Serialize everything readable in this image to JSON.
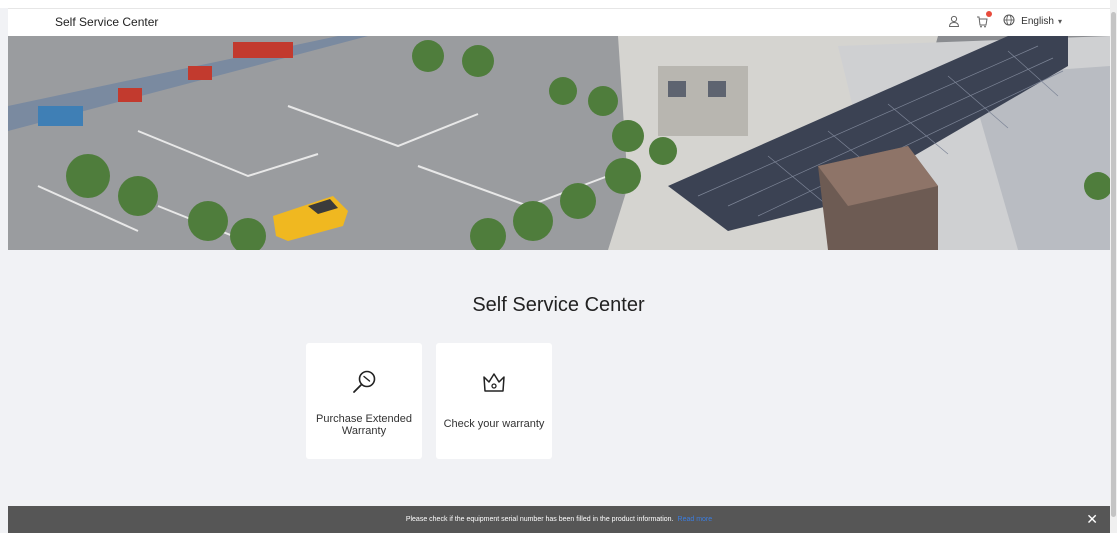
{
  "header": {
    "brand": "Self Service Center",
    "icons": [
      "user-icon",
      "cart-icon",
      "globe-icon"
    ],
    "language": {
      "label": "English",
      "caret": "▾"
    }
  },
  "hero": {
    "image": "aerial-view-of-solar-panel-building-and-parking-lot"
  },
  "main": {
    "title": "Self Service Center",
    "cards": [
      {
        "label": "Purchase Extended Warranty",
        "icon": "magnifier-icon"
      },
      {
        "label": "Check your warranty",
        "icon": "crown-icon"
      }
    ]
  },
  "notice": {
    "text": "Please check if the equipment serial number has been filled in the product information.",
    "link": "Read more",
    "close": "✕"
  },
  "colors": {
    "background": "#f1f2f5",
    "notice_bar": "#565656",
    "link": "#3b7de0",
    "cart_badge": "#e84b3c"
  }
}
